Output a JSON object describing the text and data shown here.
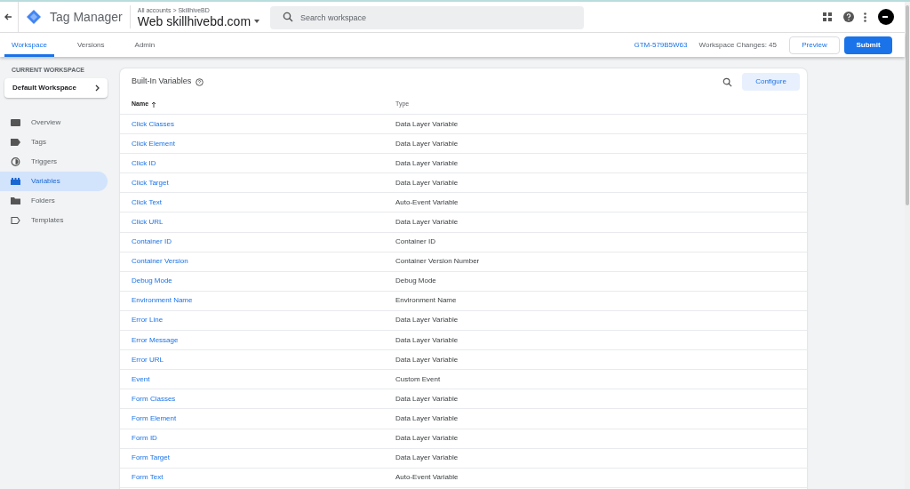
{
  "header": {
    "product": "Tag Manager",
    "breadcrumb": "All accounts > SkillhiveBD",
    "container": "Web skillhivebd.com",
    "search": {
      "placeholder": "Search workspace"
    }
  },
  "tabs": [
    {
      "label": "Workspace",
      "selected": true
    },
    {
      "label": "Versions",
      "selected": false
    },
    {
      "label": "Admin",
      "selected": false
    }
  ],
  "toolbar": {
    "container_id": "GTM-579B5W63",
    "changes": "Workspace Changes: 45",
    "buttons": [
      "Preview",
      "Submit"
    ]
  },
  "sidebar": {
    "heading": "CURRENT WORKSPACE",
    "workspace": "Default Workspace",
    "items": [
      {
        "label": "Overview",
        "selected": false
      },
      {
        "label": "Tags",
        "selected": false
      },
      {
        "label": "Triggers",
        "selected": false
      },
      {
        "label": "Variables",
        "selected": true
      },
      {
        "label": "Folders",
        "selected": false
      },
      {
        "label": "Templates",
        "selected": false
      }
    ]
  },
  "card": {
    "title": "Built-In Variables",
    "button": "Configure",
    "columns": [
      "Name",
      "Type"
    ],
    "rows": [
      [
        "Click Classes",
        "Data Layer Variable"
      ],
      [
        "Click Element",
        "Data Layer Variable"
      ],
      [
        "Click ID",
        "Data Layer Variable"
      ],
      [
        "Click Target",
        "Data Layer Variable"
      ],
      [
        "Click Text",
        "Auto-Event Variable"
      ],
      [
        "Click URL",
        "Data Layer Variable"
      ],
      [
        "Container ID",
        "Container ID"
      ],
      [
        "Container Version",
        "Container Version Number"
      ],
      [
        "Debug Mode",
        "Debug Mode"
      ],
      [
        "Environment Name",
        "Environment Name"
      ],
      [
        "Error Line",
        "Data Layer Variable"
      ],
      [
        "Error Message",
        "Data Layer Variable"
      ],
      [
        "Error URL",
        "Data Layer Variable"
      ],
      [
        "Event",
        "Custom Event"
      ],
      [
        "Form Classes",
        "Data Layer Variable"
      ],
      [
        "Form Element",
        "Data Layer Variable"
      ],
      [
        "Form ID",
        "Data Layer Variable"
      ],
      [
        "Form Target",
        "Data Layer Variable"
      ],
      [
        "Form Text",
        "Auto-Event Variable"
      ]
    ]
  }
}
